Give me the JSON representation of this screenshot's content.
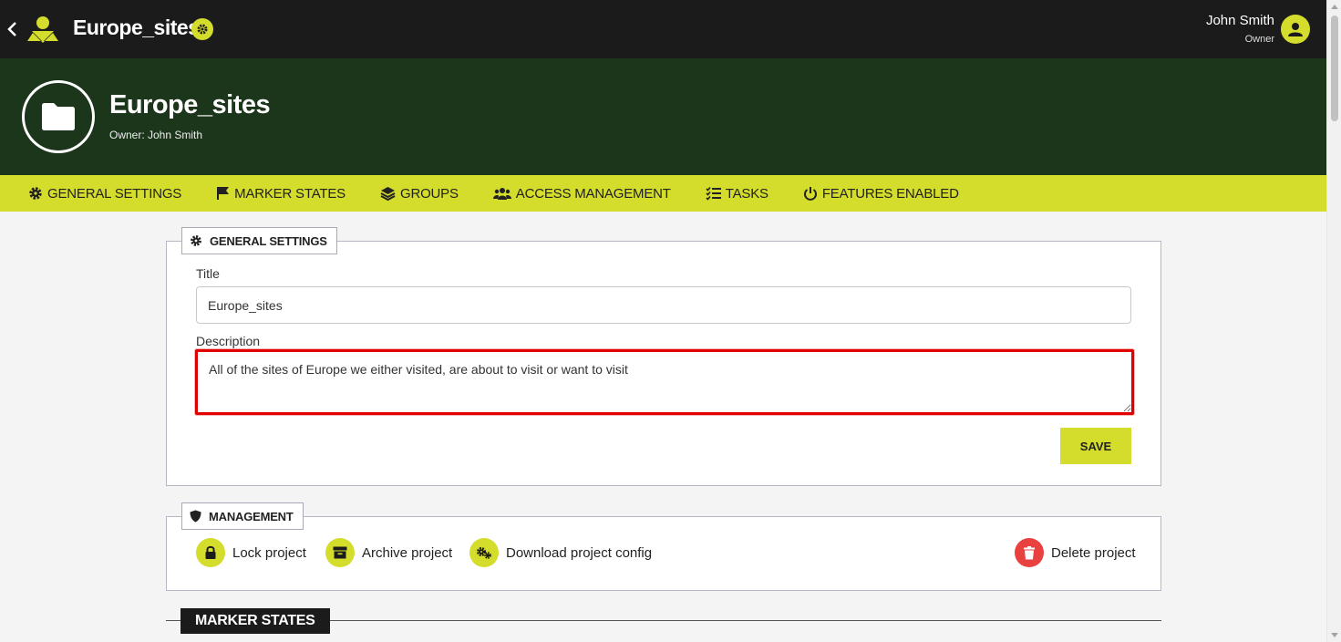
{
  "topbar": {
    "app_title": "Europe_sites",
    "user_name": "John Smith",
    "user_role": "Owner"
  },
  "banner": {
    "title": "Europe_sites",
    "owner_line": "Owner: John Smith"
  },
  "tabs": [
    {
      "label": "GENERAL SETTINGS",
      "icon": "gear-icon"
    },
    {
      "label": "MARKER STATES",
      "icon": "flag-icon"
    },
    {
      "label": "GROUPS",
      "icon": "layers-icon"
    },
    {
      "label": "ACCESS MANAGEMENT",
      "icon": "users-icon"
    },
    {
      "label": "TASKS",
      "icon": "checklist-icon"
    },
    {
      "label": "FEATURES ENABLED",
      "icon": "power-icon"
    }
  ],
  "general_settings": {
    "legend": "GENERAL SETTINGS",
    "title_label": "Title",
    "title_value": "Europe_sites",
    "description_label": "Description",
    "description_value": "All of the sites of Europe we either visited, are about to visit or want to visit",
    "save_label": "SAVE"
  },
  "management": {
    "legend": "MANAGEMENT",
    "actions": [
      {
        "label": "Lock project",
        "icon": "lock-icon"
      },
      {
        "label": "Archive project",
        "icon": "archive-icon"
      },
      {
        "label": "Download project config",
        "icon": "gears-icon"
      },
      {
        "label": "Delete project",
        "icon": "trash-icon"
      }
    ]
  },
  "marker_states": {
    "heading": "MARKER STATES"
  },
  "colors": {
    "accent": "#d4dc2c",
    "topbar": "#1b1b1b",
    "banner": "#1b361b",
    "danger": "#e94040",
    "highlight": "#e00000"
  }
}
